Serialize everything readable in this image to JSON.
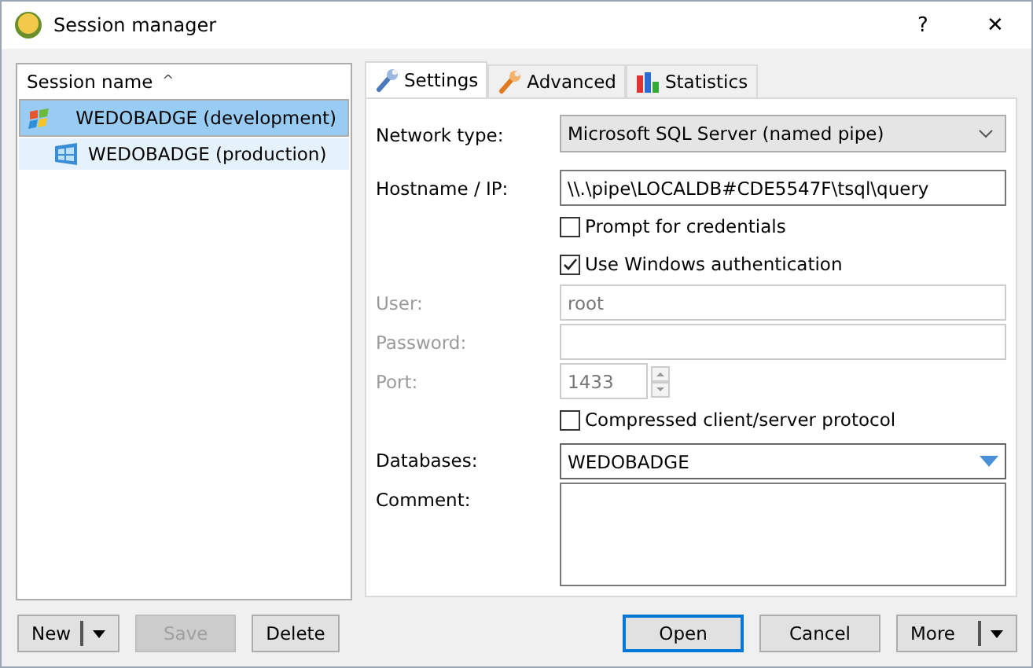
{
  "window": {
    "title": "Session manager",
    "help": "?",
    "close": "✕"
  },
  "sessions": {
    "column": "Session name",
    "sort_mark": "^",
    "items": [
      {
        "name": "WEDOBADGE (development)",
        "kind": "flag",
        "selected": true
      },
      {
        "name": "WEDOBADGE (production)",
        "kind": "windows",
        "selected": false
      }
    ]
  },
  "tabs": [
    {
      "label": "Settings",
      "kind": "wrench-blue",
      "selected": true
    },
    {
      "label": "Advanced",
      "kind": "wrench-orange",
      "selected": false
    },
    {
      "label": "Statistics",
      "kind": "chart",
      "selected": false
    }
  ],
  "fields": [
    {
      "kind": "select",
      "label": "Network type:",
      "value": "Microsoft SQL Server (named pipe)",
      "disabled": false
    },
    {
      "kind": "text",
      "label": "Hostname / IP:",
      "value": "\\\\.\\pipe\\LOCALDB#CDE5547F\\tsql\\query",
      "disabled": false
    },
    {
      "kind": "checkbox",
      "label": "Prompt for credentials",
      "checked": false,
      "disabled": false
    },
    {
      "kind": "checkbox",
      "label": "Use Windows authentication",
      "checked": true,
      "disabled": false
    },
    {
      "kind": "text",
      "label": "User:",
      "value": "root",
      "disabled": true
    },
    {
      "kind": "text",
      "label": "Password:",
      "disabled": true
    },
    {
      "kind": "spin",
      "label": "Port:",
      "value": "1433",
      "disabled": true
    },
    {
      "kind": "checkbox",
      "label": "Compressed client/server protocol",
      "checked": false,
      "disabled": false
    },
    {
      "kind": "combo",
      "label": "Databases:",
      "value": "WEDOBADGE",
      "disabled": false
    },
    {
      "kind": "memo",
      "label": "Comment:",
      "disabled": false
    }
  ],
  "left_buttons": [
    {
      "label": "New",
      "split": true,
      "disabled": false,
      "default": false
    },
    {
      "label": "Save",
      "split": false,
      "disabled": true,
      "default": false
    },
    {
      "label": "Delete",
      "split": false,
      "disabled": false,
      "default": false
    }
  ],
  "right_buttons": [
    {
      "label": "Open",
      "split": false,
      "disabled": false,
      "default": true
    },
    {
      "label": "Cancel",
      "split": false,
      "disabled": false,
      "default": false
    },
    {
      "label": "More",
      "split": true,
      "disabled": false,
      "default": false
    }
  ]
}
